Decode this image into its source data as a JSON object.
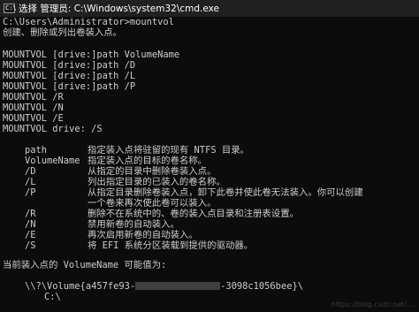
{
  "window": {
    "title": "选择 管理员: C:\\Windows\\system32\\cmd.exe",
    "icon_text": "C:\\",
    "colors": {
      "background": "#0c0c0c",
      "text": "#cccccc",
      "titlebar": "#202020"
    }
  },
  "console": {
    "prompt": "C:\\Users\\Administrator>mountvol",
    "description": "创建、删除或列出卷装入点。",
    "usage": [
      "MOUNTVOL [drive:]path VolumeName",
      "MOUNTVOL [drive:]path /D",
      "MOUNTVOL [drive:]path /L",
      "MOUNTVOL [drive:]path /P",
      "MOUNTVOL /R",
      "MOUNTVOL /N",
      "MOUNTVOL /E",
      "MOUNTVOL drive: /S"
    ],
    "options": [
      {
        "key": "path",
        "desc": "指定装入点将驻留的现有 NTFS 目录。"
      },
      {
        "key": "VolumeName",
        "desc": "指定装入点的目标的卷名称。"
      },
      {
        "key": "/D",
        "desc": "从指定的目录中删除卷装入点。"
      },
      {
        "key": "/L",
        "desc": "列出指定目录的已装入的卷名称。"
      },
      {
        "key": "/P",
        "desc": "从指定目录删除卷装入点，卸下此卷并使此卷无法装入。你可以创建"
      },
      {
        "key": "",
        "desc": "一个卷来再次使此卷可以装入。"
      },
      {
        "key": "/R",
        "desc": "删除不在系统中的、卷的装入点目录和注册表设置。"
      },
      {
        "key": "/N",
        "desc": "禁用新卷的自动装入。"
      },
      {
        "key": "/E",
        "desc": "再次启用新卷的自动装入。"
      },
      {
        "key": "/S",
        "desc": "将 EFI 系统分区装载到提供的驱动器。"
      }
    ],
    "current_label": "当前装入点的 VolumeName 可能值为:",
    "volume_prefix": "\\\\?\\Volume{a457fe93-",
    "volume_suffix": "-3098c1056bee}\\",
    "mount_point": "C:\\"
  },
  "watermark": "https://blog.csdn.net/..."
}
